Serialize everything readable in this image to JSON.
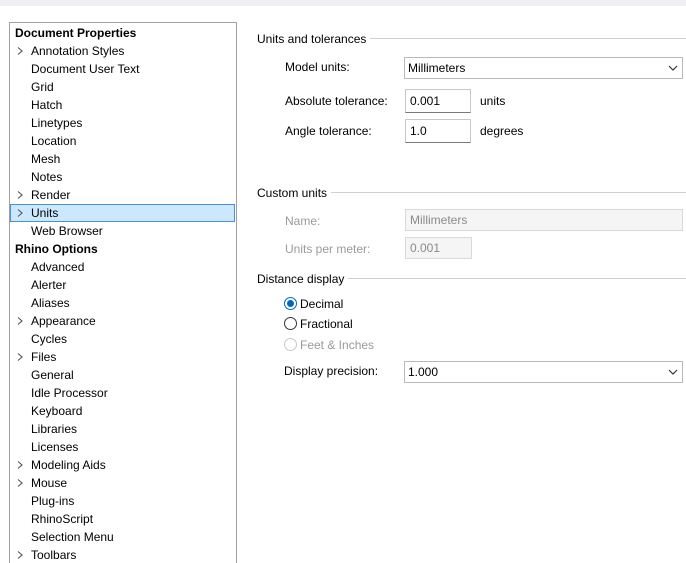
{
  "tree": {
    "items": [
      {
        "label": "Document Properties",
        "header": true,
        "chevron": false,
        "selected": false
      },
      {
        "label": "Annotation Styles",
        "header": false,
        "chevron": true,
        "selected": false
      },
      {
        "label": "Document User Text",
        "header": false,
        "chevron": false,
        "selected": false
      },
      {
        "label": "Grid",
        "header": false,
        "chevron": false,
        "selected": false
      },
      {
        "label": "Hatch",
        "header": false,
        "chevron": false,
        "selected": false
      },
      {
        "label": "Linetypes",
        "header": false,
        "chevron": false,
        "selected": false
      },
      {
        "label": "Location",
        "header": false,
        "chevron": false,
        "selected": false
      },
      {
        "label": "Mesh",
        "header": false,
        "chevron": false,
        "selected": false
      },
      {
        "label": "Notes",
        "header": false,
        "chevron": false,
        "selected": false
      },
      {
        "label": "Render",
        "header": false,
        "chevron": true,
        "selected": false
      },
      {
        "label": "Units",
        "header": false,
        "chevron": true,
        "selected": true
      },
      {
        "label": "Web Browser",
        "header": false,
        "chevron": false,
        "selected": false
      },
      {
        "label": "Rhino Options",
        "header": true,
        "chevron": false,
        "selected": false
      },
      {
        "label": "Advanced",
        "header": false,
        "chevron": false,
        "selected": false
      },
      {
        "label": "Alerter",
        "header": false,
        "chevron": false,
        "selected": false
      },
      {
        "label": "Aliases",
        "header": false,
        "chevron": false,
        "selected": false
      },
      {
        "label": "Appearance",
        "header": false,
        "chevron": true,
        "selected": false
      },
      {
        "label": "Cycles",
        "header": false,
        "chevron": false,
        "selected": false
      },
      {
        "label": "Files",
        "header": false,
        "chevron": true,
        "selected": false
      },
      {
        "label": "General",
        "header": false,
        "chevron": false,
        "selected": false
      },
      {
        "label": "Idle Processor",
        "header": false,
        "chevron": false,
        "selected": false
      },
      {
        "label": "Keyboard",
        "header": false,
        "chevron": false,
        "selected": false
      },
      {
        "label": "Libraries",
        "header": false,
        "chevron": false,
        "selected": false
      },
      {
        "label": "Licenses",
        "header": false,
        "chevron": false,
        "selected": false
      },
      {
        "label": "Modeling Aids",
        "header": false,
        "chevron": true,
        "selected": false
      },
      {
        "label": "Mouse",
        "header": false,
        "chevron": true,
        "selected": false
      },
      {
        "label": "Plug-ins",
        "header": false,
        "chevron": false,
        "selected": false
      },
      {
        "label": "RhinoScript",
        "header": false,
        "chevron": false,
        "selected": false
      },
      {
        "label": "Selection Menu",
        "header": false,
        "chevron": false,
        "selected": false
      },
      {
        "label": "Toolbars",
        "header": false,
        "chevron": true,
        "selected": false
      }
    ]
  },
  "units_tolerances": {
    "title": "Units and tolerances",
    "model_units_label": "Model units:",
    "model_units_value": "Millimeters",
    "abs_tol_label": "Absolute tolerance:",
    "abs_tol_value": "0.001",
    "abs_tol_unit": "units",
    "angle_tol_label": "Angle tolerance:",
    "angle_tol_value": "1.0",
    "angle_tol_unit": "degrees"
  },
  "custom_units": {
    "title": "Custom units",
    "name_label": "Name:",
    "name_value": "Millimeters",
    "upm_label": "Units per meter:",
    "upm_value": "0.001"
  },
  "distance_display": {
    "title": "Distance display",
    "options": [
      {
        "label": "Decimal",
        "checked": true,
        "disabled": false
      },
      {
        "label": "Fractional",
        "checked": false,
        "disabled": false
      },
      {
        "label": "Feet & Inches",
        "checked": false,
        "disabled": true
      }
    ],
    "precision_label": "Display precision:",
    "precision_value": "1.000"
  },
  "colors": {
    "selection_fill": "#cce8ff",
    "selection_border": "#4a90d9",
    "radio_accent": "#0067c0"
  }
}
